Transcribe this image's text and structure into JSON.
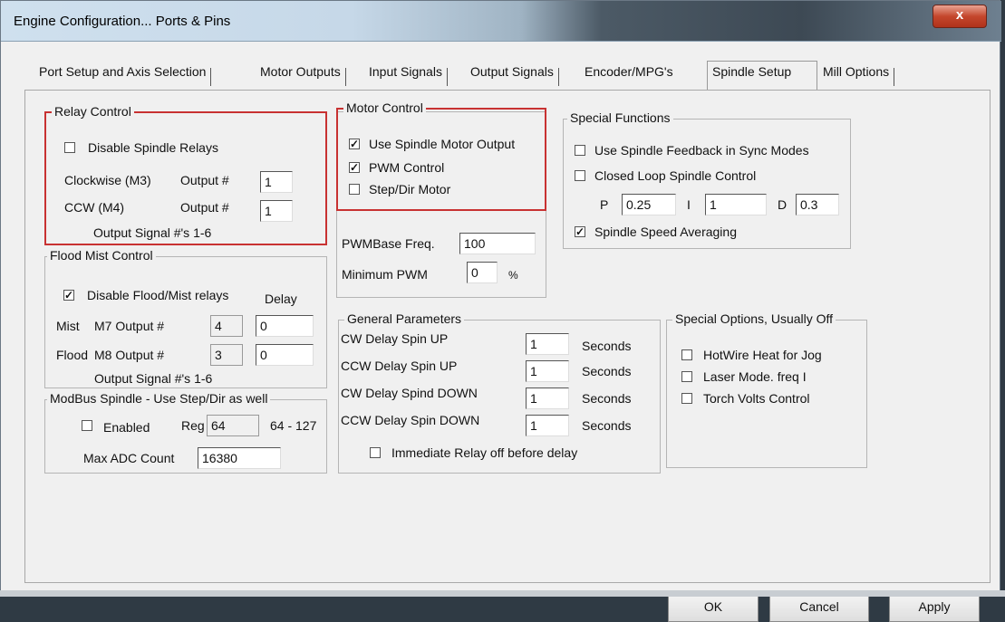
{
  "window": {
    "title": "Engine Configuration... Ports & Pins",
    "close_label": "x"
  },
  "tabs": [
    {
      "label": "Port Setup and Axis Selection"
    },
    {
      "label": "Motor Outputs"
    },
    {
      "label": "Input Signals"
    },
    {
      "label": "Output Signals"
    },
    {
      "label": "Encoder/MPG's"
    },
    {
      "label": "Spindle Setup"
    },
    {
      "label": "Mill Options"
    }
  ],
  "relay_control": {
    "legend": "Relay Control",
    "disable_label": "Disable Spindle Relays",
    "disable_checked": false,
    "cw_label": "Clockwise (M3)",
    "ccw_label": "CCW (M4)",
    "output_label": "Output #",
    "cw_output": "1",
    "ccw_output": "1",
    "note": "Output Signal #'s 1-6"
  },
  "motor_control": {
    "legend": "Motor Control",
    "use_spindle_label": "Use Spindle Motor Output",
    "use_spindle_checked": true,
    "pwm_label": "PWM Control",
    "pwm_checked": true,
    "stepdir_label": "Step/Dir Motor",
    "stepdir_checked": false,
    "pwm_base_label": "PWMBase Freq.",
    "pwm_base_value": "100",
    "min_pwm_label": "Minimum PWM",
    "min_pwm_value": "0",
    "min_pwm_unit": "%"
  },
  "special_functions": {
    "legend": "Special Functions",
    "feedback_label": "Use Spindle Feedback in Sync Modes",
    "feedback_checked": false,
    "closed_loop_label": "Closed Loop Spindle Control",
    "closed_loop_checked": false,
    "p_label": "P",
    "p_value": "0.25",
    "i_label": "I",
    "i_value": "1",
    "d_label": "D",
    "d_value": "0.3",
    "averaging_label": "Spindle Speed Averaging",
    "averaging_checked": true
  },
  "flood_mist": {
    "legend": "Flood Mist Control",
    "disable_label": "Disable Flood/Mist relays",
    "disable_checked": true,
    "delay_label": "Delay",
    "mist_label": "Mist",
    "mist_output_label": "M7 Output #",
    "mist_output": "4",
    "mist_delay": "0",
    "flood_label": "Flood",
    "flood_output_label": "M8 Output #",
    "flood_output": "3",
    "flood_delay": "0",
    "note": "Output Signal #'s 1-6"
  },
  "modbus": {
    "legend": "ModBus Spindle - Use Step/Dir as well",
    "enabled_label": "Enabled",
    "enabled_checked": false,
    "reg_label": "Reg",
    "reg_value": "64",
    "reg_range": "64 - 127",
    "max_adc_label": "Max ADC Count",
    "max_adc_value": "16380"
  },
  "general": {
    "legend": "General Parameters",
    "rows": [
      {
        "label": "CW Delay Spin UP",
        "value": "1",
        "unit": "Seconds"
      },
      {
        "label": "CCW Delay Spin UP",
        "value": "1",
        "unit": "Seconds"
      },
      {
        "label": "CW Delay Spind DOWN",
        "value": "1",
        "unit": "Seconds"
      },
      {
        "label": "CCW Delay Spin DOWN",
        "value": "1",
        "unit": "Seconds"
      }
    ],
    "immediate_label": "Immediate Relay off before delay",
    "immediate_checked": false
  },
  "special_options": {
    "legend": "Special Options, Usually Off",
    "hotwire_label": "HotWire Heat for Jog",
    "hotwire_checked": false,
    "laser_label": "Laser Mode. freq I",
    "laser_checked": false,
    "torch_label": "Torch Volts Control",
    "torch_checked": false
  },
  "buttons": {
    "ok": "OK",
    "cancel": "Cancel",
    "apply": "Apply"
  },
  "colors": {
    "highlight_border": "#c83232",
    "window_bg": "#f0f0f0"
  }
}
